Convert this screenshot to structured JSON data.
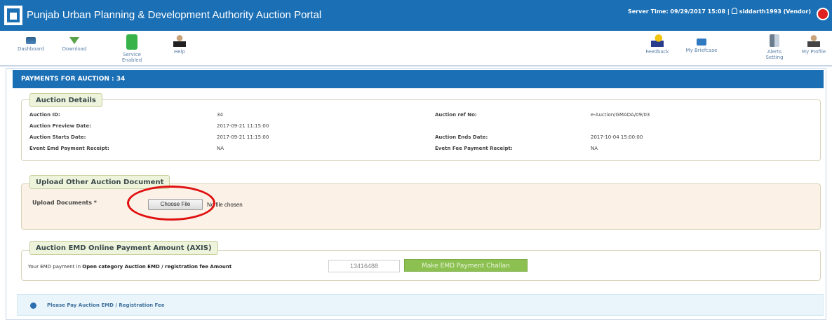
{
  "header": {
    "title": "Punjab Urban Planning & Development Authority Auction Portal",
    "server_time": "Server Time: 09/29/2017 15:08 |",
    "user": "siddarth1993 (Vendor)"
  },
  "toolbar": {
    "dashboard": "Dashboard",
    "download": "Download",
    "service_enabled": "Service Enabled",
    "help": "Help",
    "feedback": "Feedback",
    "my_briefcase": "My Briefcase",
    "alerts_setting": "Alerts Setting",
    "my_profile": "My Profile"
  },
  "panel": {
    "title": "PAYMENTS FOR AUCTION : 34"
  },
  "auction_details": {
    "legend": "Auction Details",
    "auction_id_label": "Auction ID:",
    "auction_id_value": "34",
    "auction_ref_label": "Auction ref No:",
    "auction_ref_value": "e-Auction/GMADA/09/03",
    "preview_date_label": "Auction Preview Date:",
    "preview_date_value": "2017-09-21 11:15:00",
    "starts_date_label": "Auction Starts Date:",
    "starts_date_value": "2017-09-21 11:15:00",
    "ends_date_label": "Auction Ends Date:",
    "ends_date_value": "2017-10-04 15:00:00",
    "emd_receipt_label": "Event Emd Payment Receipt:",
    "emd_receipt_value": "NA",
    "fee_receipt_label": "Evetn Fee Payment Receipt:",
    "fee_receipt_value": "NA"
  },
  "upload": {
    "legend": "Upload Other Auction Document",
    "label": "Upload Documents *",
    "choose_button": "Choose File",
    "no_file": "No file chosen"
  },
  "emd": {
    "legend": "Auction EMD Online Payment Amount (AXIS)",
    "text_prefix": "Your EMD payment in",
    "text_bold": "Open category Auction EMD / registration fee Amount",
    "amount": "13416488",
    "pay_button": "Make EMD Payment Challan"
  },
  "notice": {
    "text": "Please Pay Auction EMD / Registration Fee"
  }
}
